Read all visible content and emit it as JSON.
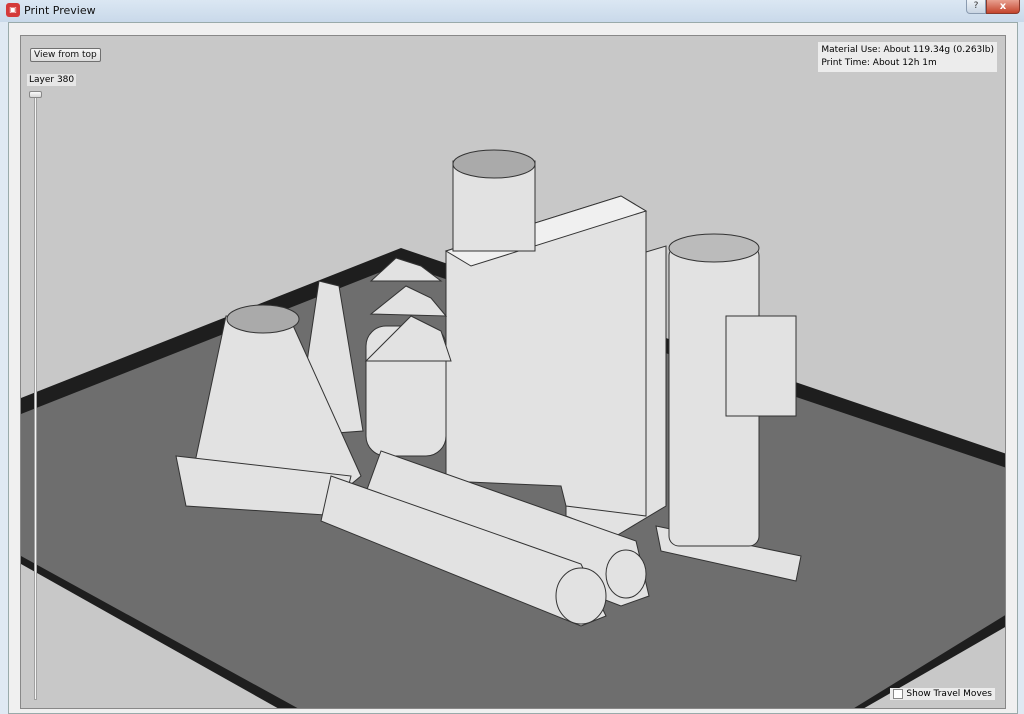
{
  "window": {
    "title": "Print Preview",
    "help": "?",
    "close": "x"
  },
  "controls": {
    "view_from_top": "View from top",
    "layer_label": "Layer 380",
    "layer_position": 1.0
  },
  "info": {
    "material": "Material Use: About 119.34g (0.263lb)",
    "time": "Print Time: About 12h 1m"
  },
  "travel": {
    "label": "Show Travel Moves",
    "checked": false
  },
  "colors": {
    "background": "#c8c8c8",
    "plate": "#6e6e6e",
    "plate_edge": "#1e1e1e",
    "model": "#e4e4e4"
  }
}
